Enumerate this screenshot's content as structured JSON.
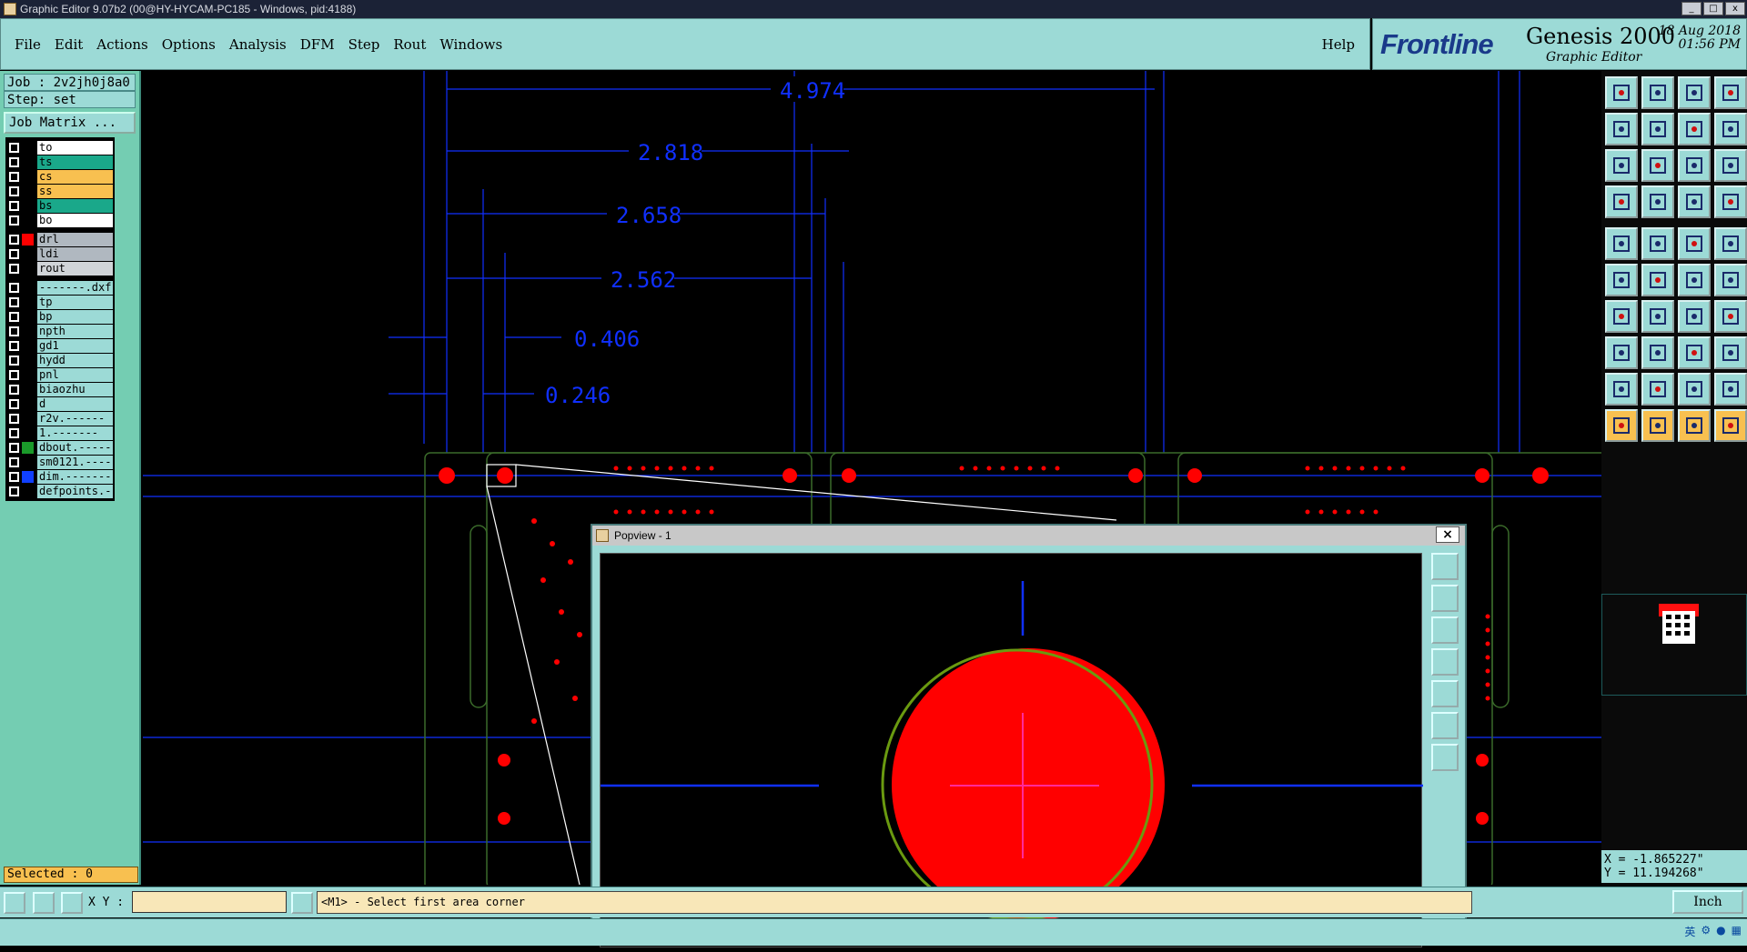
{
  "window": {
    "title": "Graphic Editor 9.07b2 (00@HY-HYCAM-PC185 - Windows, pid:4188)"
  },
  "menu": {
    "items": [
      "File",
      "Edit",
      "Actions",
      "Options",
      "Analysis",
      "DFM",
      "Step",
      "Rout",
      "Windows"
    ],
    "help": "Help"
  },
  "brand": {
    "logo": "Frontline",
    "product": "Genesis 2000",
    "subtitle": "Graphic Editor",
    "date": "18 Aug 2018",
    "time": "01:56 PM"
  },
  "job": {
    "job_label": "Job : 2v2jh0j8a0",
    "step_label": "Step: set",
    "matrix_button": "Job Matrix ..."
  },
  "layers": [
    {
      "name": "to",
      "color": "#ffffff",
      "group": 1
    },
    {
      "name": "ts",
      "color": "#1aa88a",
      "group": 1
    },
    {
      "name": "cs",
      "color": "#f8c050",
      "group": 1
    },
    {
      "name": "ss",
      "color": "#f8c050",
      "group": 1
    },
    {
      "name": "bs",
      "color": "#1aa88a",
      "group": 1
    },
    {
      "name": "bo",
      "color": "#ffffff",
      "group": 1
    },
    {
      "name": "drl",
      "color": "#b0b8c0",
      "swatch": "#ff0000",
      "group": 2
    },
    {
      "name": "ldi",
      "color": "#b0b8c0",
      "group": 2
    },
    {
      "name": "rout",
      "color": "#d0d4d8",
      "group": 2
    },
    {
      "name": "-------.dxf",
      "color": "#9cdad6",
      "group": 3
    },
    {
      "name": "tp",
      "color": "#9cdad6",
      "group": 3
    },
    {
      "name": "bp",
      "color": "#9cdad6",
      "group": 3
    },
    {
      "name": "npth",
      "color": "#9cdad6",
      "group": 3
    },
    {
      "name": "gd1",
      "color": "#9cdad6",
      "group": 3
    },
    {
      "name": "hydd",
      "color": "#9cdad6",
      "group": 3
    },
    {
      "name": "pnl",
      "color": "#9cdad6",
      "group": 3
    },
    {
      "name": "biaozhu",
      "color": "#9cdad6",
      "group": 3
    },
    {
      "name": "d",
      "color": "#9cdad6",
      "group": 3
    },
    {
      "name": "r2v.------",
      "color": "#9cdad6",
      "group": 3
    },
    {
      "name": "1.-------",
      "color": "#9cdad6",
      "group": 3
    },
    {
      "name": "dbout.-----",
      "color": "#9cdad6",
      "swatch": "#1a9a2a",
      "group": 3
    },
    {
      "name": "sm0121.----",
      "color": "#9cdad6",
      "group": 3
    },
    {
      "name": "dim.-------",
      "color": "#9cdad6",
      "swatch": "#1040ff",
      "group": 3
    },
    {
      "name": "defpoints.-",
      "color": "#9cdad6",
      "group": 3
    }
  ],
  "selected": "Selected : 0",
  "dimensions": [
    "4.974",
    "2.818",
    "2.658",
    "2.562",
    "0.406",
    "0.246"
  ],
  "popview": {
    "title": "Popview - 1",
    "close": "×"
  },
  "coords": {
    "x": "X = -1.865227\"",
    "y": "Y = 11.194268\""
  },
  "status": {
    "xy_label": "X Y :",
    "xy_value": "",
    "message": "<M1> - Select first area corner",
    "unit": "Inch"
  },
  "tray": {
    "ime": "英"
  },
  "colors": {
    "panel": "#9cdad6",
    "panel_dark": "#74cdb2",
    "dim_line": "#1030ff",
    "pad": "#ff0000",
    "outline": "#3a6a2a"
  }
}
